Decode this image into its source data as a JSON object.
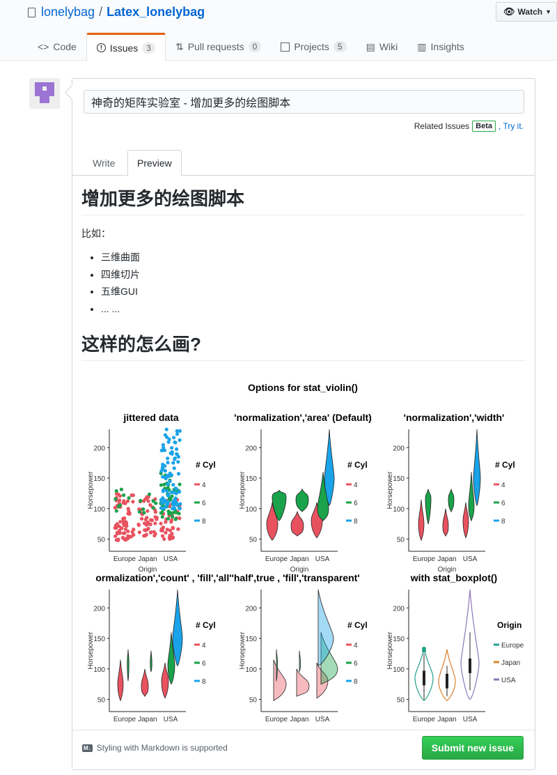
{
  "repo": {
    "owner": "lonelybag",
    "name": "Latex_lonelybag"
  },
  "watch_label": "Watch",
  "tabs": [
    {
      "label": "Code"
    },
    {
      "label": "Issues",
      "count": "3"
    },
    {
      "label": "Pull requests",
      "count": "0"
    },
    {
      "label": "Projects",
      "count": "5"
    },
    {
      "label": "Wiki"
    },
    {
      "label": "Insights"
    }
  ],
  "issue": {
    "title_value": "神奇的矩阵实验室 - 增加更多的绘图脚本",
    "related_text": "Related Issues",
    "beta": "Beta",
    "try_it": ", Try it."
  },
  "write_tabs": {
    "write": "Write",
    "preview": "Preview"
  },
  "preview": {
    "heading1": "增加更多的绘图脚本",
    "para": "比如：",
    "items": [
      "三维曲面",
      "四维切片",
      "五维GUI",
      "... ..."
    ],
    "heading2": "这样的怎么画?"
  },
  "figure": {
    "title": "Options for stat_violin()",
    "panels": [
      {
        "title": "jittered data"
      },
      {
        "title": "'normalization','area' (Default)"
      },
      {
        "title": "'normalization','width'"
      },
      {
        "title": "ormalization','count' , 'fill','all''half',true , 'fill','transparent'"
      },
      {
        "title": "with stat_boxplot()"
      }
    ],
    "ylabel": "Horsepower",
    "xlabel": "Origin",
    "x_categories": [
      "Europe",
      "Japan",
      "USA"
    ],
    "y_ticks": [
      "200",
      "150",
      "100",
      "50"
    ],
    "legend_cyl": {
      "title": "# Cyl",
      "items": [
        "4",
        "6",
        "8"
      ]
    },
    "legend_origin": {
      "title": "Origin",
      "items": [
        "Europe",
        "Japan",
        "USA"
      ]
    },
    "colors": {
      "cyl4": "#e8525f",
      "cyl6": "#1aa34a",
      "cyl8": "#1aa3e8",
      "europe": "#20a08a",
      "japan": "#d9822b",
      "usa": "#8b76b8"
    }
  },
  "footer": {
    "markdown_note": "Styling with Markdown is supported",
    "submit": "Submit new issue"
  },
  "colors": {
    "link": "#0366d6",
    "issues_tab_accent": "#e36209",
    "submit_green": "#28a745"
  }
}
